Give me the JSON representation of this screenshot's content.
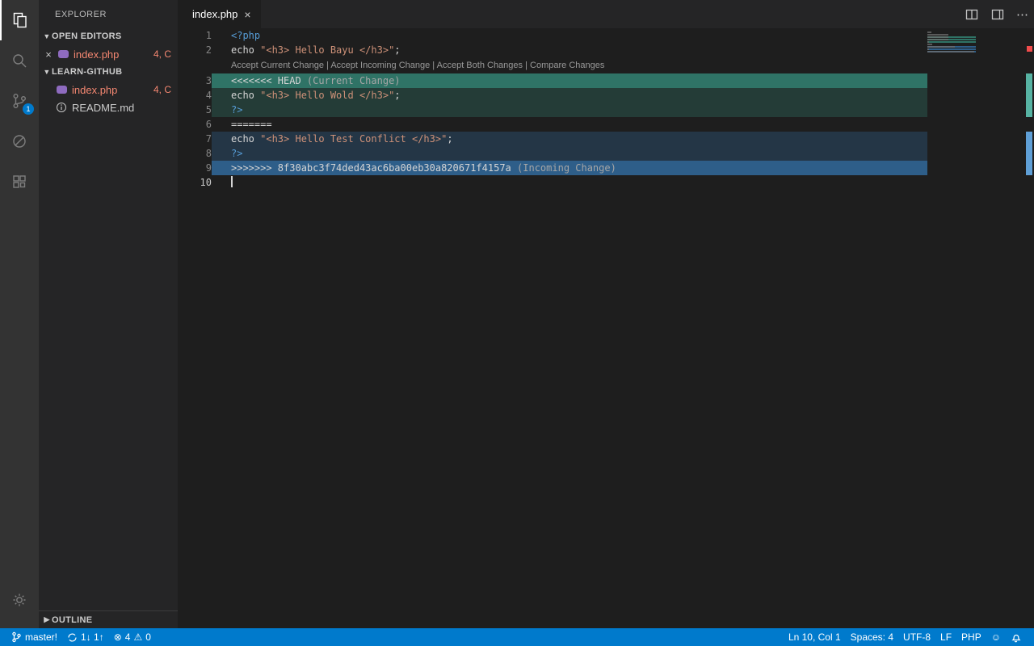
{
  "colors": {
    "current_header_bg": "rgba(64,200,174,0.50)",
    "current_content_bg": "rgba(64,200,174,0.18)",
    "incoming_header_bg": "rgba(64,166,255,0.48)",
    "incoming_content_bg": "rgba(64,166,255,0.18)"
  },
  "icons": {
    "close": "×",
    "chevron_down": "▼",
    "chevron_right": "▶",
    "more": "⋯",
    "error": "⊗",
    "warning": "⚠",
    "smiley": "☺"
  },
  "activity_bar": {
    "source_control_badge": "1"
  },
  "sidebar": {
    "title": "EXPLORER",
    "open_editors": {
      "header": "OPEN EDITORS",
      "items": [
        {
          "label": "index.php",
          "decoration": "4, C"
        }
      ]
    },
    "folder": {
      "header": "LEARN-GITHUB",
      "items": [
        {
          "label": "index.php",
          "decoration": "4, C"
        },
        {
          "label": "README.md",
          "decoration": ""
        }
      ]
    },
    "outline_header": "OUTLINE"
  },
  "tab": {
    "label": "index.php"
  },
  "editor": {
    "active_line": 10,
    "codelens": {
      "before_line": 3,
      "separator": " | ",
      "actions": [
        "Accept Current Change",
        "Accept Incoming Change",
        "Accept Both Changes",
        "Compare Changes"
      ]
    },
    "lines": [
      {
        "n": 1,
        "tokens": [
          [
            "tag",
            "<?php"
          ]
        ]
      },
      {
        "n": 2,
        "tokens": [
          [
            "plain",
            "echo "
          ],
          [
            "str",
            "\"<h3> Hello Bayu </h3>\""
          ],
          [
            "plain",
            ";"
          ]
        ]
      },
      {
        "n": 3,
        "bg": "cur-head",
        "tokens": [
          [
            "plain",
            "<<<<<<< HEAD "
          ],
          [
            "desc",
            "(Current Change)"
          ]
        ]
      },
      {
        "n": 4,
        "bg": "cur-body",
        "tokens": [
          [
            "plain",
            "echo "
          ],
          [
            "str",
            "\"<h3> Hello Wold </h3>\""
          ],
          [
            "plain",
            ";"
          ]
        ]
      },
      {
        "n": 5,
        "bg": "cur-body",
        "tokens": [
          [
            "tag",
            "?>"
          ]
        ]
      },
      {
        "n": 6,
        "tokens": [
          [
            "plain",
            "======="
          ]
        ]
      },
      {
        "n": 7,
        "bg": "inc-body",
        "tokens": [
          [
            "plain",
            "echo "
          ],
          [
            "str",
            "\"<h3> Hello Test Conflict </h3>\""
          ],
          [
            "plain",
            ";"
          ]
        ]
      },
      {
        "n": 8,
        "bg": "inc-body",
        "tokens": [
          [
            "tag",
            "?>"
          ]
        ]
      },
      {
        "n": 9,
        "bg": "inc-head",
        "tokens": [
          [
            "plain",
            ">>>>>>> 8f30abc3f74ded43ac6ba00eb30a820671f4157a "
          ],
          [
            "desc",
            "(Incoming Change)"
          ]
        ]
      },
      {
        "n": 10,
        "cursor": true,
        "tokens": []
      }
    ]
  },
  "status_bar": {
    "branch": "master!",
    "sync": "1↓ 1↑",
    "errors": "4",
    "warnings": "0",
    "position": "Ln 10, Col 1",
    "indent": "Spaces: 4",
    "encoding": "UTF-8",
    "eol": "LF",
    "language": "PHP"
  }
}
